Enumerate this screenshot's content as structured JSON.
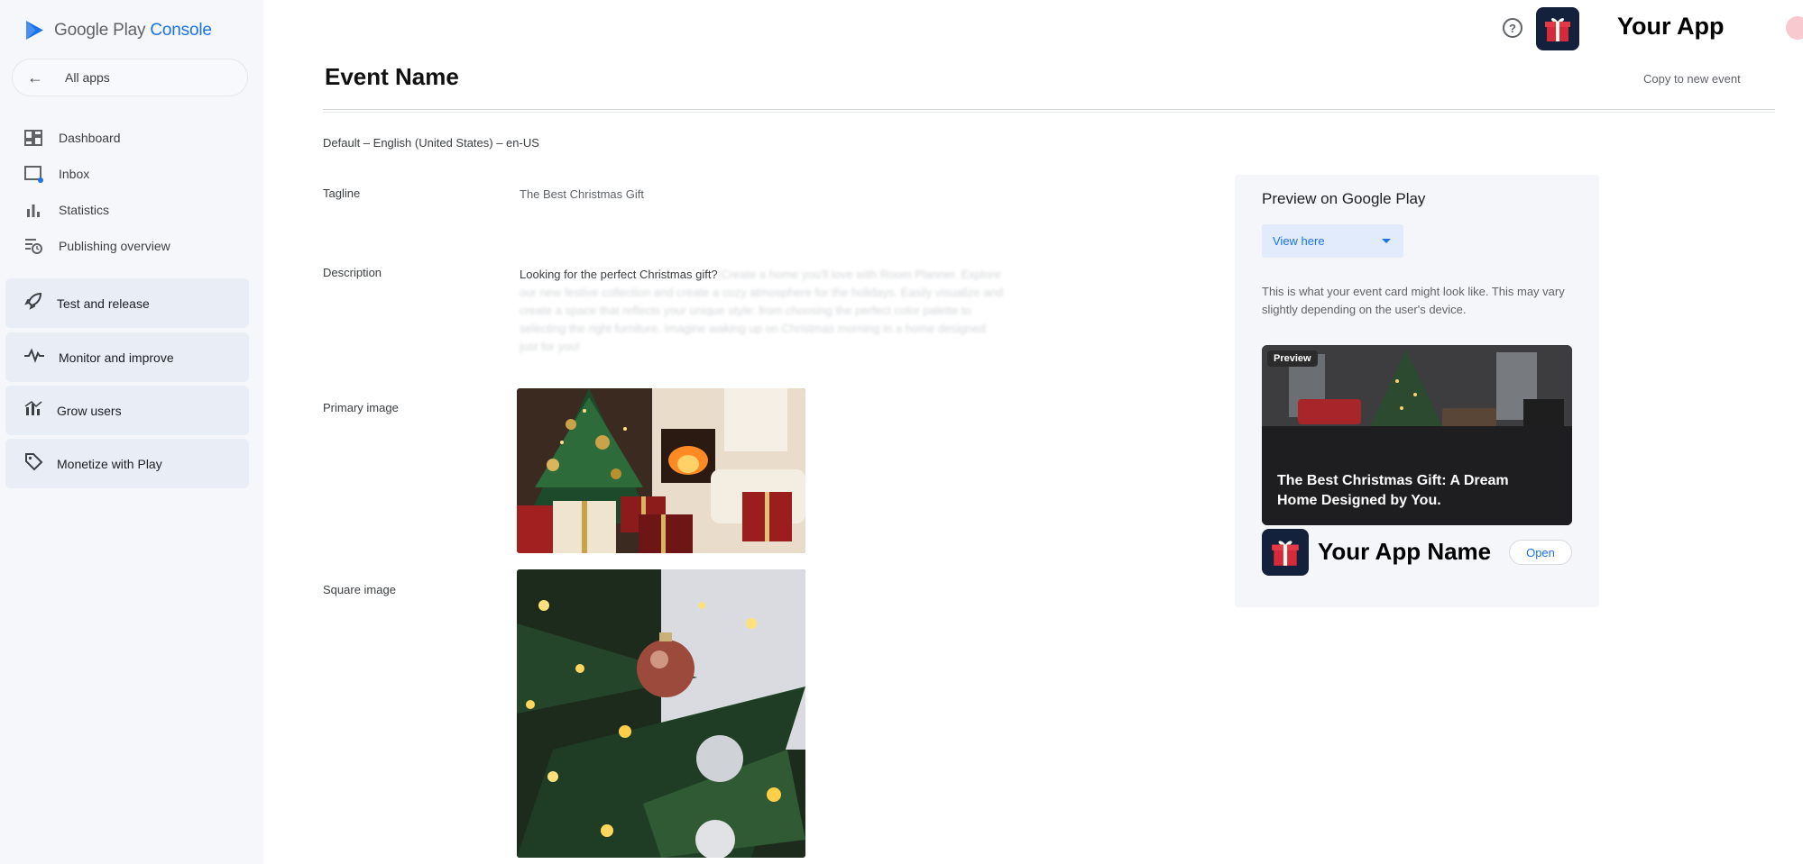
{
  "brand": {
    "name": "Google Play",
    "product": "Console"
  },
  "nav": {
    "all_apps": "All apps",
    "items": [
      {
        "label": "Dashboard",
        "icon": "dashboard-icon"
      },
      {
        "label": "Inbox",
        "icon": "inbox-icon"
      },
      {
        "label": "Statistics",
        "icon": "bar-chart-icon"
      },
      {
        "label": "Publishing overview",
        "icon": "publishing-icon"
      }
    ],
    "groups": [
      {
        "label": "Test and release",
        "icon": "rocket-icon"
      },
      {
        "label": "Monitor and improve",
        "icon": "pulse-icon"
      },
      {
        "label": "Grow users",
        "icon": "grow-icon"
      },
      {
        "label": "Monetize with Play",
        "icon": "tag-icon"
      }
    ]
  },
  "topbar": {
    "help": "?",
    "app_title": "Your App"
  },
  "page": {
    "title": "Event Name",
    "copy_link": "Copy to new event",
    "locale": "Default – English (United States) – en-US"
  },
  "fields": {
    "tagline_label": "Tagline",
    "tagline_value": "The Best Christmas Gift",
    "description_label": "Description",
    "description_lead": "Looking for the perfect Christmas gift?",
    "description_rest": "Create a home you'll love with Room Planner. Explore our new festive collection and create a cozy atmosphere for the holidays. Easily visualize and create a space that reflects your unique style: from choosing the perfect color palette to selecting the right furniture. Imagine waking up on Christmas morning in a home designed just for you!",
    "primary_image_label": "Primary image",
    "square_image_label": "Square image"
  },
  "preview": {
    "title": "Preview on Google Play",
    "view_select": "View here",
    "note": "This is what your event card might look like. This may vary slightly depending on the user's device.",
    "chip": "Preview",
    "headline": "The Best Christmas Gift: A Dream Home Designed by You.",
    "app_name": "Your App Name",
    "open_button": "Open"
  },
  "colors": {
    "accent": "#1a73e8",
    "sidebar_bg": "#f5f7fb",
    "nav_group_bg": "#e8edf6",
    "app_badge_bg": "#14213d"
  }
}
